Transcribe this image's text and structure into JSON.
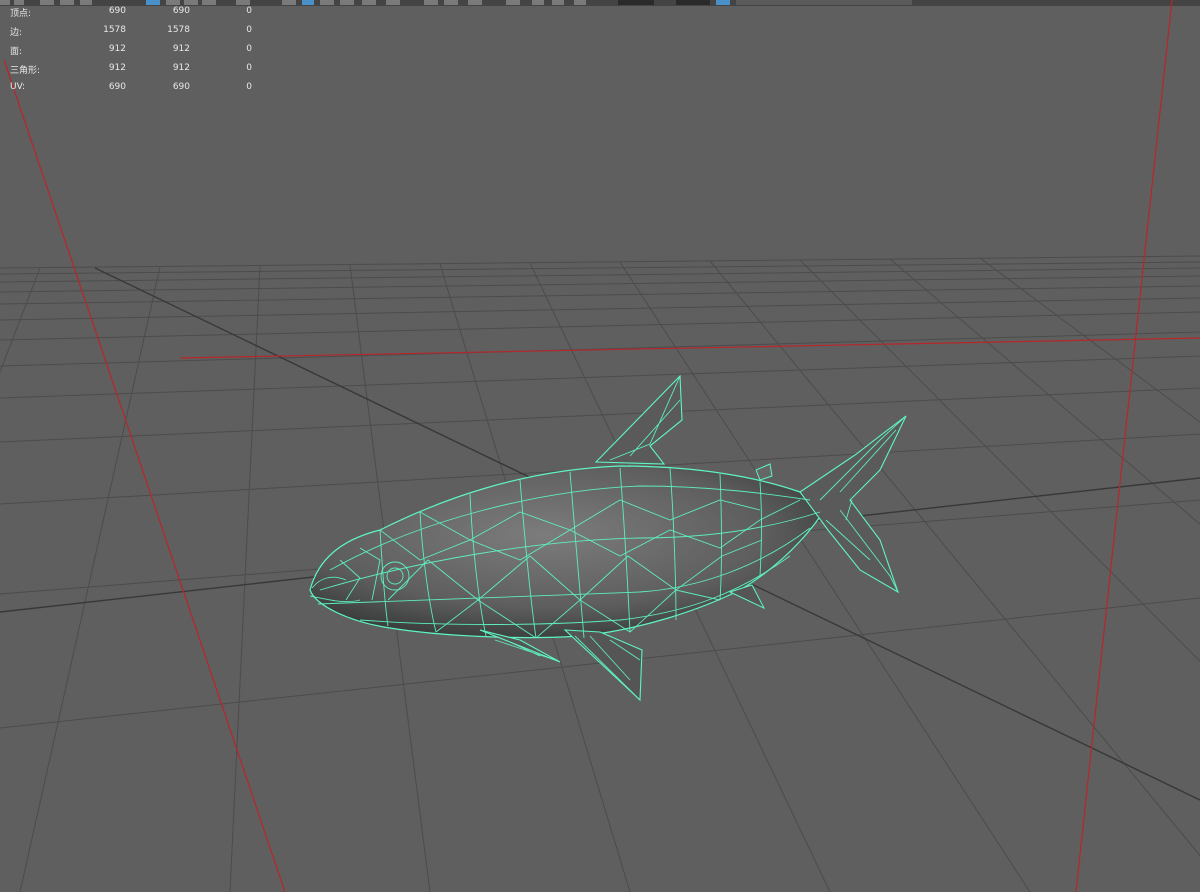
{
  "hud": {
    "rows": [
      {
        "label": "顶点:",
        "v1": "690",
        "v2": "690",
        "v3": "0"
      },
      {
        "label": "边:",
        "v1": "1578",
        "v2": "1578",
        "v3": "0"
      },
      {
        "label": "面:",
        "v1": "912",
        "v2": "912",
        "v3": "0"
      },
      {
        "label": "三角形:",
        "v1": "912",
        "v2": "912",
        "v3": "0"
      },
      {
        "label": "UV:",
        "v1": "690",
        "v2": "690",
        "v3": "0"
      }
    ]
  },
  "colors": {
    "background": "#5f5f5f",
    "grid": "#4a4a4a",
    "axis_red": "#c0282a",
    "wireframe": "#5ff5c0",
    "mesh_shade": "#6a6a6a"
  }
}
